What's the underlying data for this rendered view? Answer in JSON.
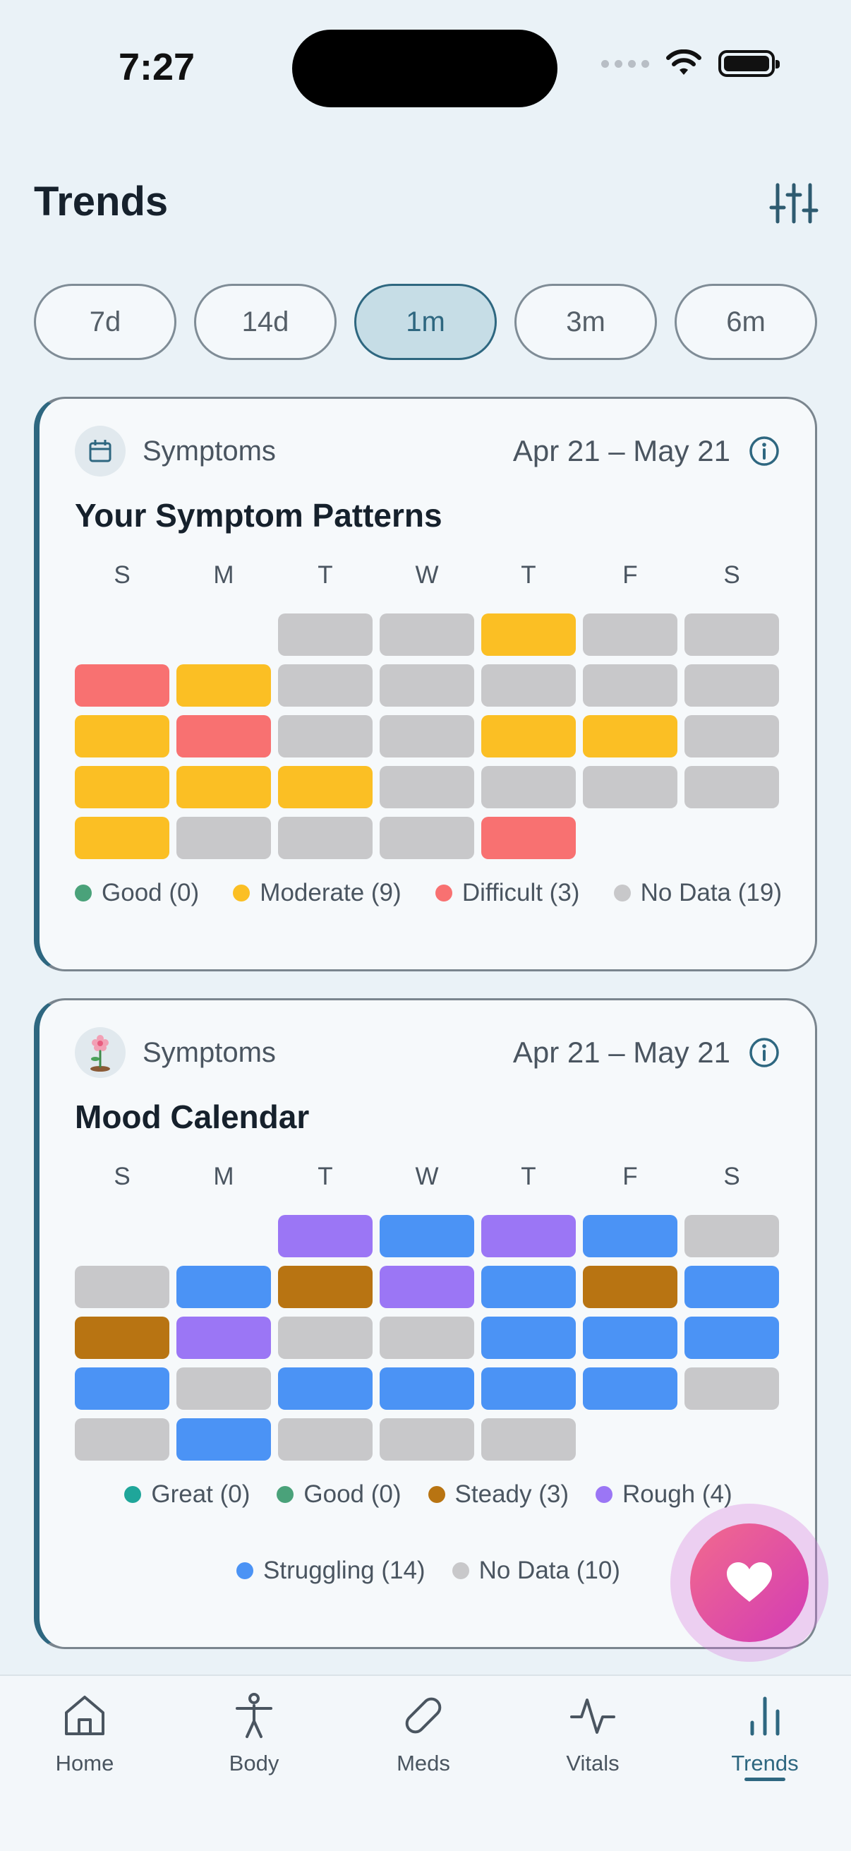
{
  "status_bar": {
    "time": "7:27"
  },
  "header": {
    "title": "Trends",
    "filter_icon": "sliders-icon"
  },
  "range_chips": [
    {
      "label": "7d",
      "active": false
    },
    {
      "label": "14d",
      "active": false
    },
    {
      "label": "1m",
      "active": true
    },
    {
      "label": "3m",
      "active": false
    },
    {
      "label": "6m",
      "active": false
    }
  ],
  "colors": {
    "good_symptom": "#4aa27a",
    "moderate": "#fbbf24",
    "difficult": "#f87171",
    "no_data": "#c8c8ca",
    "great": "#1fa69a",
    "good_mood": "#4aa27a",
    "steady": "#b87412",
    "rough": "#9b76f5",
    "struggling": "#4b93f5",
    "accent": "#2e6780"
  },
  "cards": {
    "symptoms": {
      "category": "Symptoms",
      "date_range": "Apr 21 – May 21",
      "title": "Your Symptom Patterns",
      "weekdays": [
        "S",
        "M",
        "T",
        "W",
        "T",
        "F",
        "S"
      ],
      "cells": [
        null,
        null,
        "no_data",
        "no_data",
        "moderate",
        "no_data",
        "no_data",
        "difficult",
        "moderate",
        "no_data",
        "no_data",
        "no_data",
        "no_data",
        "no_data",
        "moderate",
        "difficult",
        "no_data",
        "no_data",
        "moderate",
        "moderate",
        "no_data",
        "moderate",
        "moderate",
        "moderate",
        "no_data",
        "no_data",
        "no_data",
        "no_data",
        "moderate",
        "no_data",
        "no_data",
        "no_data",
        "difficult",
        null,
        null
      ],
      "legend": [
        {
          "key": "good_symptom",
          "label": "Good (0)"
        },
        {
          "key": "moderate",
          "label": "Moderate (9)"
        },
        {
          "key": "difficult",
          "label": "Difficult (3)"
        },
        {
          "key": "no_data",
          "label": "No Data (19)"
        }
      ]
    },
    "mood": {
      "category": "Symptoms",
      "date_range": "Apr 21 – May 21",
      "title": "Mood Calendar",
      "weekdays": [
        "S",
        "M",
        "T",
        "W",
        "T",
        "F",
        "S"
      ],
      "cells": [
        null,
        null,
        "rough",
        "struggling",
        "rough",
        "struggling",
        "no_data",
        "no_data",
        "struggling",
        "steady",
        "rough",
        "struggling",
        "steady",
        "struggling",
        "steady",
        "rough",
        "no_data",
        "no_data",
        "struggling",
        "struggling",
        "struggling",
        "struggling",
        "no_data",
        "struggling",
        "struggling",
        "struggling",
        "struggling",
        "no_data",
        "no_data",
        "struggling",
        "no_data",
        "no_data",
        "no_data",
        null,
        null
      ],
      "legend_row1": [
        {
          "key": "great",
          "label": "Great (0)"
        },
        {
          "key": "good_mood",
          "label": "Good (0)"
        },
        {
          "key": "steady",
          "label": "Steady (3)"
        },
        {
          "key": "rough",
          "label": "Rough (4)"
        }
      ],
      "legend_row2": [
        {
          "key": "struggling",
          "label": "Struggling (14)"
        },
        {
          "key": "no_data",
          "label": "No Data (10)"
        }
      ]
    }
  },
  "tabbar": [
    {
      "label": "Home",
      "icon": "home-icon",
      "active": false
    },
    {
      "label": "Body",
      "icon": "body-icon",
      "active": false
    },
    {
      "label": "Meds",
      "icon": "pill-icon",
      "active": false
    },
    {
      "label": "Vitals",
      "icon": "pulse-icon",
      "active": false
    },
    {
      "label": "Trends",
      "icon": "bar-chart-icon",
      "active": true
    }
  ]
}
